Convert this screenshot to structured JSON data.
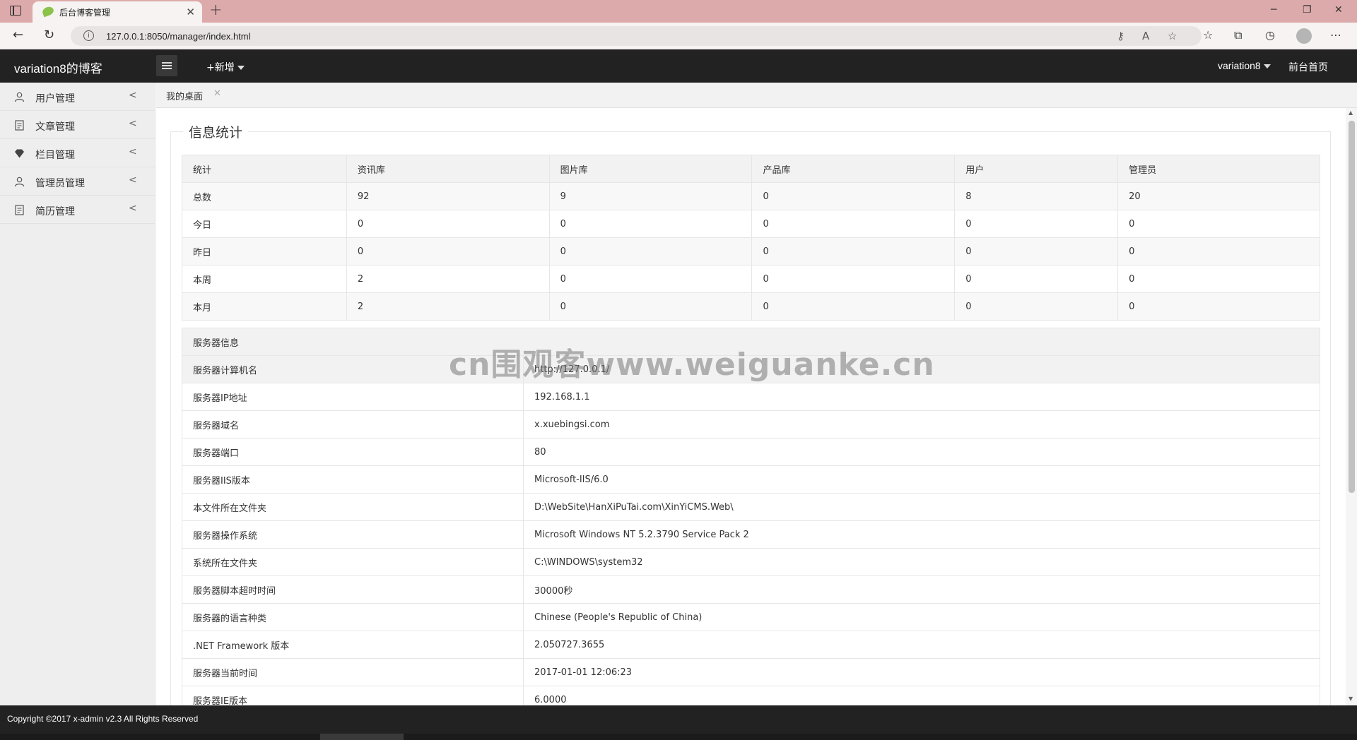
{
  "browser": {
    "tab_title": "后台博客管理",
    "tab_close": "✕",
    "new_tab": "+",
    "url": "127.0.0.1:8050/manager/index.html",
    "url_info_icon": "i"
  },
  "header": {
    "logo": "variation8的博客",
    "add_new": "+新增",
    "user": "variation8",
    "front_home": "前台首页"
  },
  "sidebar": {
    "items": [
      {
        "label": "用户管理",
        "icon": "user-icon"
      },
      {
        "label": "文章管理",
        "icon": "document-icon"
      },
      {
        "label": "栏目管理",
        "icon": "diamond-icon"
      },
      {
        "label": "管理员管理",
        "icon": "user-icon"
      },
      {
        "label": "简历管理",
        "icon": "document-icon"
      }
    ],
    "arrow": "<"
  },
  "page_tabs": {
    "desktop": "我的桌面",
    "close": "✕"
  },
  "stats": {
    "title": "信息统计",
    "headers": [
      "统计",
      "资讯库",
      "图片库",
      "产品库",
      "用户",
      "管理员"
    ],
    "rows": [
      [
        "总数",
        "92",
        "9",
        "0",
        "8",
        "20"
      ],
      [
        "今日",
        "0",
        "0",
        "0",
        "0",
        "0"
      ],
      [
        "昨日",
        "0",
        "0",
        "0",
        "0",
        "0"
      ],
      [
        "本周",
        "2",
        "0",
        "0",
        "0",
        "0"
      ],
      [
        "本月",
        "2",
        "0",
        "0",
        "0",
        "0"
      ]
    ]
  },
  "server": {
    "header": "服务器信息",
    "rows": [
      [
        "服务器计算机名",
        "http://127.0.0.1/"
      ],
      [
        "服务器IP地址",
        "192.168.1.1"
      ],
      [
        "服务器域名",
        "x.xuebingsi.com"
      ],
      [
        "服务器端口",
        "80"
      ],
      [
        "服务器IIS版本",
        "Microsoft-IIS/6.0"
      ],
      [
        "本文件所在文件夹",
        "D:\\WebSite\\HanXiPuTai.com\\XinYiCMS.Web\\"
      ],
      [
        "服务器操作系统",
        "Microsoft Windows NT 5.2.3790 Service Pack 2"
      ],
      [
        "系统所在文件夹",
        "C:\\WINDOWS\\system32"
      ],
      [
        "服务器脚本超时时间",
        "30000秒"
      ],
      [
        "服务器的语言种类",
        "Chinese (People's Republic of China)"
      ],
      [
        ".NET Framework 版本",
        "2.050727.3655"
      ],
      [
        "服务器当前时间",
        "2017-01-01 12:06:23"
      ],
      [
        "服务器IE版本",
        "6.0000"
      ]
    ]
  },
  "watermark": "cn围观客www.weiguanke.cn",
  "footer": {
    "copyright": "Copyright ©2017 x-admin v2.3 All Rights Reserved"
  }
}
